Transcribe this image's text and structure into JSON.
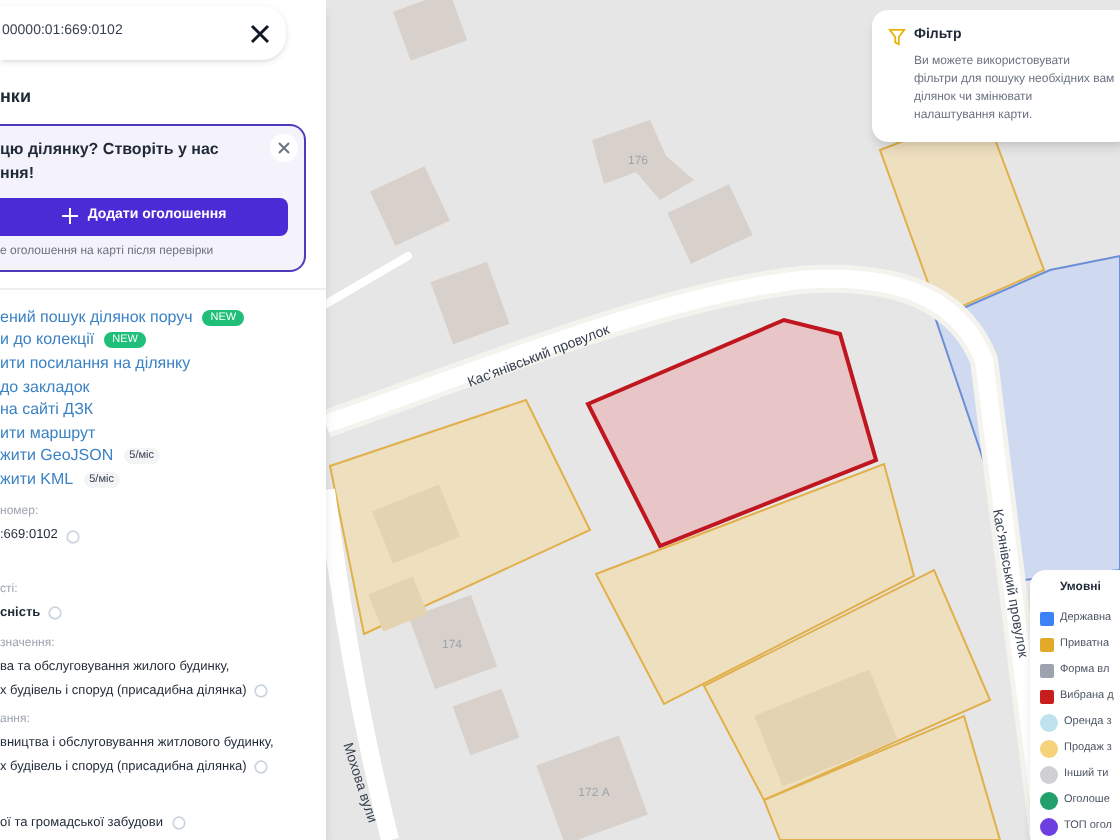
{
  "search": {
    "value": "00000:01:669:0102"
  },
  "section_title": "нки",
  "promo": {
    "lines": [
      "цю ділянку? Створіть у нас",
      "ння!"
    ],
    "button": "Додати оголошення",
    "note": "е оголошення на карті після перевірки"
  },
  "actions": [
    {
      "label": "ений пошук ділянок поруч",
      "badge": {
        "text": "NEW",
        "kind": "new"
      }
    },
    {
      "label": "и до колекції",
      "badge": {
        "text": "NEW",
        "kind": "new"
      }
    },
    {
      "label": "ити посилання на ділянку"
    },
    {
      "label": "до закладок"
    },
    {
      "label": "на сайті ДЗК"
    },
    {
      "label": "ити маршрут"
    },
    {
      "label": "жити GeoJSON",
      "badge": {
        "text": "5/міс",
        "kind": "limit"
      }
    },
    {
      "label": "жити KML",
      "badge": {
        "text": "5/міс",
        "kind": "limit"
      }
    }
  ],
  "properties": [
    {
      "label": "номер:",
      "lines": [
        ":669:0102"
      ]
    },
    {
      "label": "сті:",
      "lines": [
        "сність"
      ]
    },
    {
      "label": "значення:",
      "lines": [
        "ва та обслуговування жилого будинку,",
        "х будівель і споруд (присадибна ділянка)"
      ]
    },
    {
      "label": "ання:",
      "lines": [
        "вництва і обслуговування житлового будинку,",
        "х будівель і споруд (присадибна ділянка)"
      ]
    },
    {
      "lines": [
        "ої та громадської забудови"
      ]
    }
  ],
  "map": {
    "labels": [
      {
        "text": "176",
        "kind": "house"
      },
      {
        "text": "174",
        "kind": "house"
      },
      {
        "text": "172 А",
        "kind": "house"
      },
      {
        "text": "Кас'янівський провулок",
        "kind": "street"
      },
      {
        "text": "Кас'янівський провулок",
        "kind": "street"
      },
      {
        "text": "Мохова вули",
        "kind": "street"
      }
    ]
  },
  "filter_tip": {
    "title": "Фільтр",
    "text": "Ви можете використовувати фільтри для пошуку необхідних вам ділянок чи змінювати налаштування карти."
  },
  "legend": {
    "title": "Умовні",
    "items": [
      {
        "label": "Державна",
        "kind": "square",
        "color": "#3b82f6"
      },
      {
        "label": "Приватна",
        "kind": "square",
        "color": "#e3a92b"
      },
      {
        "label": "Форма вл",
        "kind": "square",
        "color": "#9ca3af"
      },
      {
        "label": "Вибрана д",
        "kind": "square",
        "color": "#c81e1e"
      },
      {
        "label": "Оренда з",
        "kind": "circle",
        "color": "#bfe3ee"
      },
      {
        "label": "Продаж з",
        "kind": "circle",
        "color": "#f6d27a"
      },
      {
        "label": "Інший ти",
        "kind": "circle",
        "color": "#cfcfd4"
      },
      {
        "label": "Оголоше",
        "kind": "circle",
        "color": "#22a06b"
      },
      {
        "label": "ТОП огол",
        "kind": "circle",
        "color": "#6d3fe0"
      }
    ]
  }
}
